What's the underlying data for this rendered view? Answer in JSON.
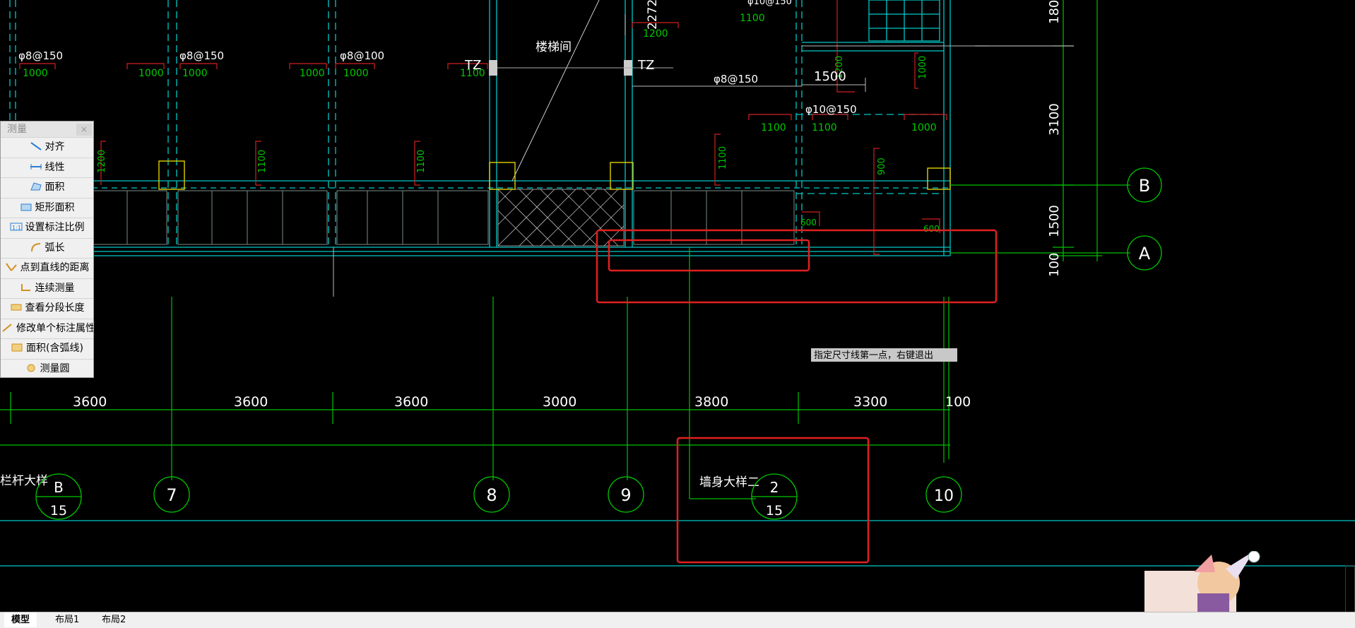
{
  "measure_panel": {
    "title": "测量",
    "close": "×",
    "items": [
      {
        "label": "对齐",
        "icon": "align-measure-icon"
      },
      {
        "label": "线性",
        "icon": "linear-measure-icon"
      },
      {
        "label": "面积",
        "icon": "area-icon"
      },
      {
        "label": "矩形面积",
        "icon": "rect-area-icon"
      },
      {
        "label": "设置标注比例",
        "icon": "scale-icon"
      },
      {
        "label": "弧长",
        "icon": "arc-length-icon"
      },
      {
        "label": "点到直线的距离",
        "icon": "point-line-distance-icon"
      },
      {
        "label": "连续测量",
        "icon": "continuous-measure-icon"
      },
      {
        "label": "查看分段长度",
        "icon": "segment-length-icon"
      },
      {
        "label": "修改单个标注属性",
        "icon": "edit-dimension-icon"
      },
      {
        "label": "面积(含弧线)",
        "icon": "arc-area-icon"
      },
      {
        "label": "测量圆",
        "icon": "circle-measure-icon"
      }
    ]
  },
  "drawing": {
    "rebar_labels": [
      "φ8@150",
      "φ8@150",
      "φ8@100",
      "φ8@150",
      "φ10@150",
      "φ10@150"
    ],
    "green_small": [
      "1000",
      "1000",
      "1000",
      "1000",
      "1000",
      "1100",
      "1100",
      "1100",
      "1200",
      "1100",
      "1100",
      "1200",
      "1100",
      "900",
      "1000",
      "1000",
      "600",
      "600",
      "2272"
    ],
    "stair_label": "楼梯间",
    "tz_left": "TZ",
    "tz_right": "TZ",
    "dim_1500": "1500",
    "right_dims": [
      "180",
      "3100",
      "1500",
      "100"
    ],
    "bottom_dims": [
      "3600",
      "3600",
      "3600",
      "3000",
      "3800",
      "3300",
      "100"
    ],
    "axis_B": "B",
    "axis_A": "A",
    "grid_labels": [
      "7",
      "8",
      "9",
      "10"
    ],
    "detail1": {
      "text": "栏杆大样",
      "top": "B",
      "bottom": "15"
    },
    "detail2": {
      "text": "墙身大样二",
      "top": "2",
      "bottom": "15"
    },
    "command_prompt": "指定尺寸线第一点，右键退出"
  },
  "tabs": [
    "模型",
    "布局1",
    "布局2"
  ],
  "colors": {
    "background": "#000000",
    "cyan": "#00d8d8",
    "green": "#00c800",
    "red": "#e02020",
    "yellow": "#e0d000",
    "white": "#ffffff"
  }
}
